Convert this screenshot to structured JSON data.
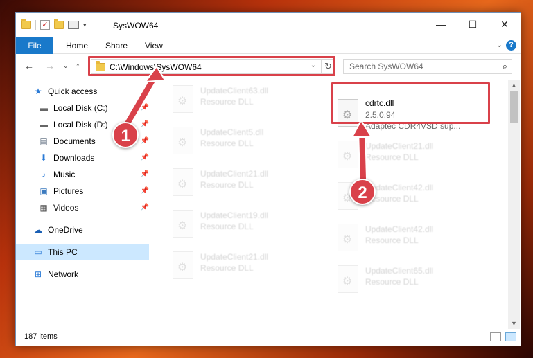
{
  "window": {
    "title": "SysWOW64",
    "controls": {
      "minimize": "—",
      "maximize": "☐",
      "close": "✕"
    }
  },
  "ribbon": {
    "tabs": [
      "File",
      "Home",
      "Share",
      "View"
    ],
    "help": "?"
  },
  "address": {
    "path": "C:\\Windows\\SysWOW64"
  },
  "search": {
    "placeholder": "Search SysWOW64"
  },
  "navpane": {
    "items": [
      {
        "label": "Quick access",
        "icon": "star-icon"
      },
      {
        "label": "Local Disk (C:)",
        "icon": "drive-icon",
        "pinned": true
      },
      {
        "label": "Local Disk (D:)",
        "icon": "drive-icon",
        "pinned": true
      },
      {
        "label": "Documents",
        "icon": "documents-icon",
        "pinned": true
      },
      {
        "label": "Downloads",
        "icon": "download-icon",
        "pinned": true
      },
      {
        "label": "Music",
        "icon": "music-icon",
        "pinned": true
      },
      {
        "label": "Pictures",
        "icon": "pictures-icon",
        "pinned": true
      },
      {
        "label": "Videos",
        "icon": "videos-icon",
        "pinned": true
      },
      {
        "label": "OneDrive",
        "icon": "cloud-icon"
      },
      {
        "label": "This PC",
        "icon": "computer-icon",
        "selected": true
      },
      {
        "label": "Network",
        "icon": "network-icon"
      }
    ]
  },
  "files": {
    "target": {
      "name": "cdrtc.dll",
      "version": "2.5.0.94",
      "description": "Adaptec CDR4VSD sup..."
    },
    "left_column": [
      {
        "name": "UpdateClient63.dll",
        "type": "Resource DLL"
      },
      {
        "name": "UpdateClient5.dll",
        "type": "Resource DLL"
      },
      {
        "name": "UpdateClient21.dll",
        "type": "Resource DLL"
      },
      {
        "name": "UpdateClient19.dll",
        "type": "Resource DLL"
      },
      {
        "name": "UpdateClient21.dll",
        "type": "Resource DLL"
      }
    ],
    "right_column": [
      {
        "name": "UpdateClient21.dll",
        "type": "Resource DLL"
      },
      {
        "name": "UpdateClient42.dll",
        "type": "Resource DLL"
      },
      {
        "name": "UpdateClient42.dll",
        "type": "Resource DLL"
      },
      {
        "name": "UpdateClient65.dll",
        "type": "Resource DLL"
      }
    ]
  },
  "status": {
    "item_count": "187 items"
  },
  "callouts": {
    "step1": "1",
    "step2": "2",
    "color": "#d9414a"
  }
}
